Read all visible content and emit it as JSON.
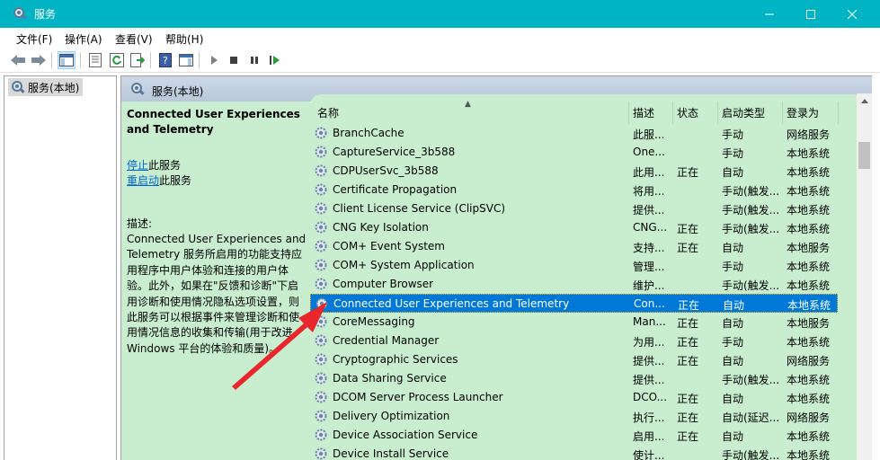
{
  "window": {
    "title": "服务"
  },
  "menu": [
    "文件(F)",
    "操作(A)",
    "查看(V)",
    "帮助(H)"
  ],
  "tree": {
    "root_label": "服务(本地)"
  },
  "pane": {
    "header": "服务(本地)"
  },
  "details": {
    "service_name": "Connected User Experiences and Telemetry",
    "stop_link": "停止",
    "stop_suffix": "此服务",
    "restart_link": "重启动",
    "restart_suffix": "此服务",
    "desc_label": "描述:",
    "description": "Connected User Experiences and Telemetry 服务所启用的功能支持应用程序中用户体验和连接的用户体验。此外，如果在\"反馈和诊断\"下启用诊断和使用情况隐私选项设置，则此服务可以根据事件来管理诊断和使用情况信息的收集和传输(用于改进 Windows 平台的体验和质量)。"
  },
  "columns": {
    "name": "名称",
    "desc": "描述",
    "status": "状态",
    "startup": "启动类型",
    "logon": "登录为"
  },
  "services": [
    {
      "name": "BranchCache",
      "desc": "此服...",
      "status": "",
      "startup": "手动",
      "logon": "网络服务"
    },
    {
      "name": "CaptureService_3b588",
      "desc": "One...",
      "status": "",
      "startup": "手动",
      "logon": "本地系统"
    },
    {
      "name": "CDPUserSvc_3b588",
      "desc": "此用...",
      "status": "正在",
      "startup": "自动",
      "logon": "本地系统"
    },
    {
      "name": "Certificate Propagation",
      "desc": "将用...",
      "status": "",
      "startup": "手动(触发...",
      "logon": "本地系统"
    },
    {
      "name": "Client License Service (ClipSVC)",
      "desc": "提供...",
      "status": "",
      "startup": "手动(触发...",
      "logon": "本地系统"
    },
    {
      "name": "CNG Key Isolation",
      "desc": "CNG...",
      "status": "正在",
      "startup": "手动(触发...",
      "logon": "本地系统"
    },
    {
      "name": "COM+ Event System",
      "desc": "支持...",
      "status": "正在",
      "startup": "自动",
      "logon": "本地服务"
    },
    {
      "name": "COM+ System Application",
      "desc": "管理...",
      "status": "",
      "startup": "手动",
      "logon": "本地系统"
    },
    {
      "name": "Computer Browser",
      "desc": "维护...",
      "status": "",
      "startup": "手动(触发...",
      "logon": "本地系统"
    },
    {
      "name": "Connected User Experiences and Telemetry",
      "desc": "Con...",
      "status": "正在",
      "startup": "自动",
      "logon": "本地系统",
      "selected": true
    },
    {
      "name": "CoreMessaging",
      "desc": "Man...",
      "status": "正在",
      "startup": "自动",
      "logon": "本地服务"
    },
    {
      "name": "Credential Manager",
      "desc": "为用...",
      "status": "正在",
      "startup": "手动",
      "logon": "本地系统"
    },
    {
      "name": "Cryptographic Services",
      "desc": "提供...",
      "status": "正在",
      "startup": "自动",
      "logon": "网络服务"
    },
    {
      "name": "Data Sharing Service",
      "desc": "提供...",
      "status": "",
      "startup": "手动(触发...",
      "logon": "本地系统"
    },
    {
      "name": "DCOM Server Process Launcher",
      "desc": "DCO...",
      "status": "正在",
      "startup": "自动",
      "logon": "本地系统"
    },
    {
      "name": "Delivery Optimization",
      "desc": "执行...",
      "status": "正在",
      "startup": "自动(延迟...",
      "logon": "网络服务"
    },
    {
      "name": "Device Association Service",
      "desc": "启用...",
      "status": "正在",
      "startup": "自动",
      "logon": "本地系统"
    },
    {
      "name": "Device Install Service",
      "desc": "使计...",
      "status": "",
      "startup": "手动(触发...",
      "logon": "本地系统"
    }
  ],
  "colors": {
    "titlebar": "#00b4c4",
    "list_bg": "#c8edcf",
    "selection": "#0078d7",
    "arrow": "#e8262b",
    "link": "#0066cc"
  }
}
